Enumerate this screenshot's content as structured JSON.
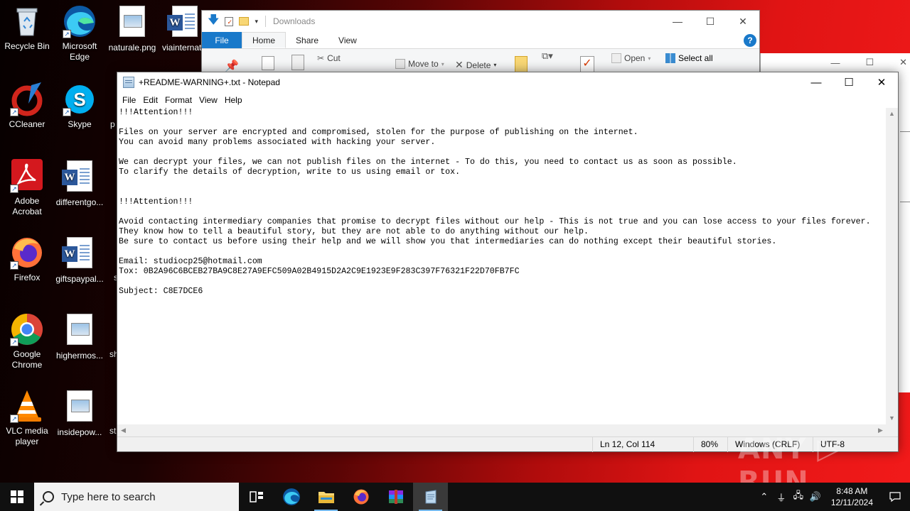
{
  "desktop": {
    "icons": [
      {
        "label": "Recycle Bin"
      },
      {
        "label": "Microsoft Edge"
      },
      {
        "label": "naturale.png"
      },
      {
        "label": "viainternat"
      },
      {
        "label": "CCleaner"
      },
      {
        "label": "Skype"
      },
      {
        "label": "p"
      },
      {
        "label": "Adobe Acrobat"
      },
      {
        "label": "differentgo..."
      },
      {
        "label": "Firefox"
      },
      {
        "label": "giftspaypal..."
      },
      {
        "label": "s"
      },
      {
        "label": "Google Chrome"
      },
      {
        "label": "highermos..."
      },
      {
        "label": "sh"
      },
      {
        "label": "VLC media player"
      },
      {
        "label": "insidepow..."
      },
      {
        "label": "st"
      }
    ]
  },
  "explorer": {
    "title": "Downloads",
    "tabs": [
      "File",
      "Home",
      "Share",
      "View"
    ],
    "help": "?",
    "ribbon": {
      "cut": "Cut",
      "move_to": "Move to",
      "delete": "Delete",
      "open": "Open",
      "select_all": "Select all"
    },
    "controls": {
      "minimize": "—",
      "maximize": "☐",
      "close": "✕"
    }
  },
  "bg_window": {
    "controls": [
      "—",
      "☐",
      "✕"
    ]
  },
  "notepad": {
    "title": "+README-WARNING+.txt - Notepad",
    "controls": {
      "minimize": "—",
      "maximize": "☐",
      "close": "✕"
    },
    "menu": [
      "File",
      "Edit",
      "Format",
      "View",
      "Help"
    ],
    "content": "!!!Attention!!!\n\nFiles on your server are encrypted and compromised, stolen for the purpose of publishing on the internet.\nYou can avoid many problems associated with hacking your server.\n\nWe can decrypt your files, we can not publish files on the internet - To do this, you need to contact us as soon as possible.\nTo clarify the details of decryption, write to us using email or tox.\n\n\n!!!Attention!!!\n\nAvoid contacting intermediary companies that promise to decrypt files without our help - This is not true and you can lose access to your files forever.\nThey know how to tell a beautiful story, but they are not able to do anything without our help.\nBe sure to contact us before using their help and we will show you that intermediaries can do nothing except their beautiful stories.\n\nEmail: studiocp25@hotmail.com\nTox: 0B2A96C6BCEB27BA9C8E27A9EFC509A02B4915D2A2C9E1923E9F283C397F76321F22D70FB7FC\n\nSubject: C8E7DCE6",
    "status": {
      "position": "Ln 12, Col 114",
      "zoom": "80%",
      "line_endings": "Windows (CRLF)",
      "encoding": "UTF-8"
    }
  },
  "watermark": "ANY ▷ RUN",
  "taskbar": {
    "search_placeholder": "Type here to search",
    "time": "8:48 AM",
    "date": "12/11/2024"
  }
}
